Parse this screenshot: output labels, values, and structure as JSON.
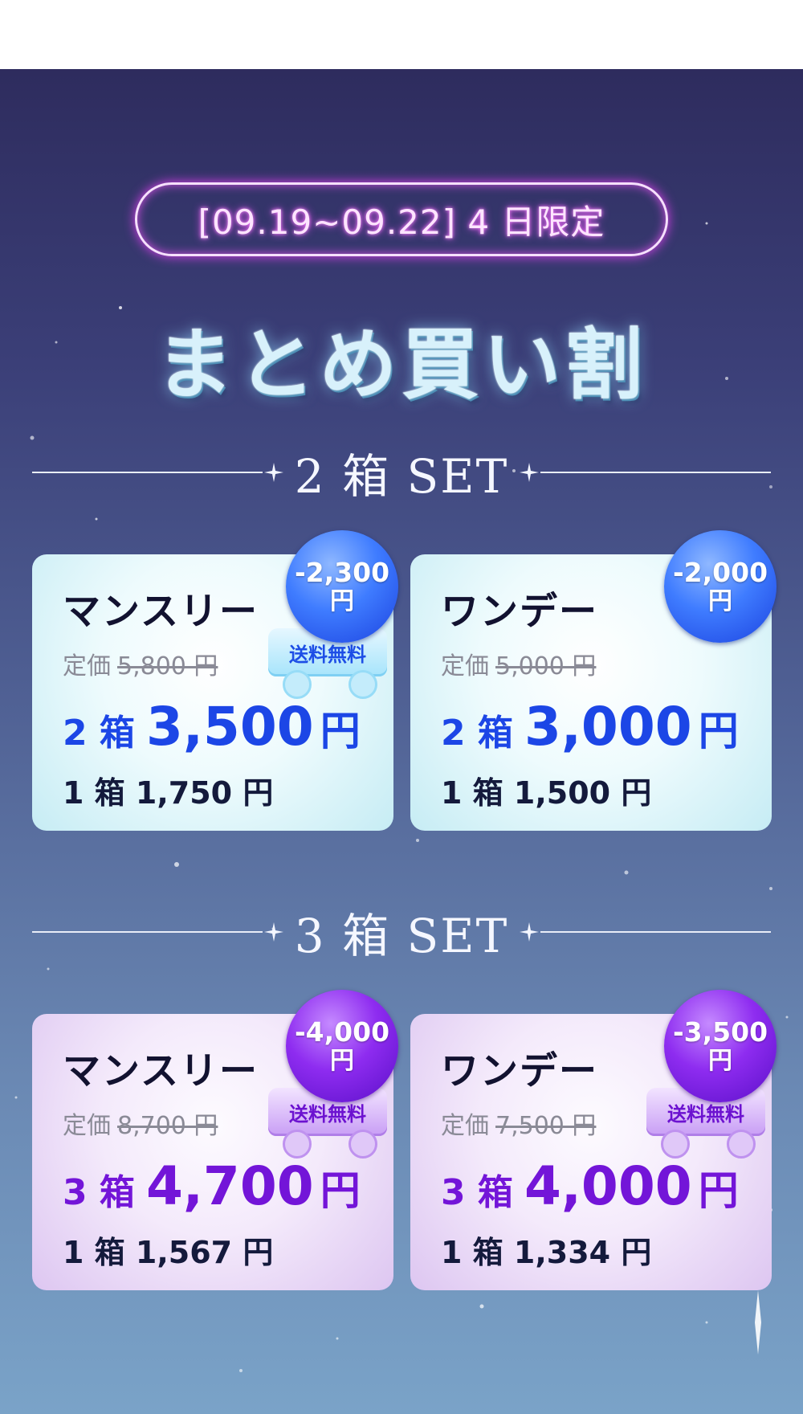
{
  "campaign": {
    "period": "[09.19~09.22] 4 日限定",
    "title": "まとめ買い割"
  },
  "sections": [
    {
      "heading": "2 箱 SET",
      "cards": [
        {
          "name": "マンスリー",
          "list_label": "定価",
          "list_price": "5,800 円",
          "box_count": "2 箱",
          "set_amount": "3,500",
          "yen": "円",
          "unit_price": "1 箱 1,750 円",
          "discount": "-2,300",
          "discount_yen": "円",
          "free_shipping": "送料無料"
        },
        {
          "name": "ワンデー",
          "list_label": "定価",
          "list_price": "5,000 円",
          "box_count": "2 箱",
          "set_amount": "3,000",
          "yen": "円",
          "unit_price": "1 箱 1,500 円",
          "discount": "-2,000",
          "discount_yen": "円"
        }
      ]
    },
    {
      "heading": "3 箱 SET",
      "cards": [
        {
          "name": "マンスリー",
          "list_label": "定価",
          "list_price": "8,700 円",
          "box_count": "3 箱",
          "set_amount": "4,700",
          "yen": "円",
          "unit_price": "1 箱 1,567 円",
          "discount": "-4,000",
          "discount_yen": "円",
          "free_shipping": "送料無料"
        },
        {
          "name": "ワンデー",
          "list_label": "定価",
          "list_price": "7,500 円",
          "box_count": "3 箱",
          "set_amount": "4,000",
          "yen": "円",
          "unit_price": "1 箱 1,334 円",
          "discount": "-3,500",
          "discount_yen": "円",
          "free_shipping": "送料無料"
        }
      ]
    }
  ],
  "colors": {
    "two_box_accent": "#1c46e6",
    "three_box_accent": "#7315d8",
    "pill_glow": "#e040f0"
  }
}
